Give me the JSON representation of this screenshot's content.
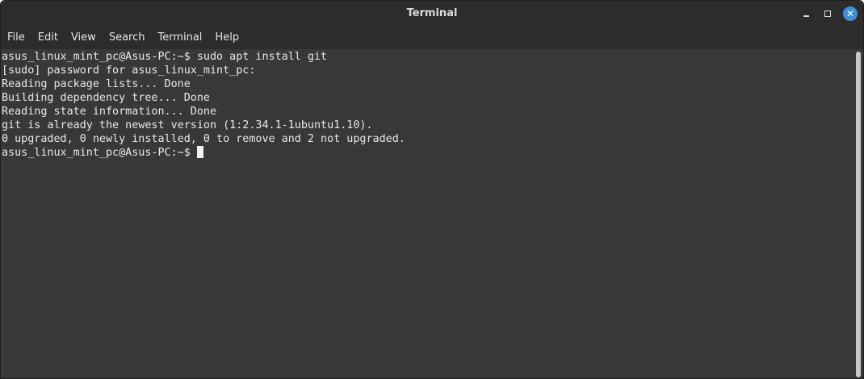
{
  "window": {
    "title": "Terminal"
  },
  "menubar": {
    "items": [
      "File",
      "Edit",
      "View",
      "Search",
      "Terminal",
      "Help"
    ]
  },
  "terminal": {
    "lines": [
      "asus_linux_mint_pc@Asus-PC:~$ sudo apt install git",
      "[sudo] password for asus_linux_mint_pc:",
      "Reading package lists... Done",
      "Building dependency tree... Done",
      "Reading state information... Done",
      "git is already the newest version (1:2.34.1-1ubuntu1.10).",
      "0 upgraded, 0 newly installed, 0 to remove and 2 not upgraded.",
      "asus_linux_mint_pc@Asus-PC:~$ "
    ]
  },
  "icons": {
    "minimize": "minimize-icon",
    "maximize": "maximize-icon",
    "close": "close-icon"
  },
  "colors": {
    "background": "#383838",
    "titlebar": "#2c2c2c",
    "text": "#e8e8e8",
    "close_button": "#3d8fdb"
  }
}
